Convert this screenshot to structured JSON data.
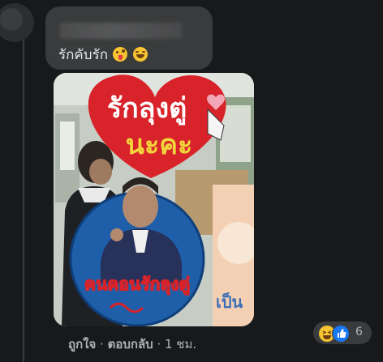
{
  "comment": {
    "text": "รักคับรัก",
    "emojis": [
      "zany-face",
      "grinning-squinting-face"
    ]
  },
  "photo": {
    "sign_top_line1": "รักลุงตู่",
    "sign_top_line2": "นะคะ",
    "sign_bottom": "คนคอนรักลุงตู่",
    "right_banner_text": "เป็น"
  },
  "footer": {
    "like": "ถูกใจ",
    "separator1": " · ",
    "reply": "ตอบกลับ",
    "separator2": " · ",
    "time": "1 ชม."
  },
  "reactions": {
    "count": "6",
    "icons": [
      "haha-icon",
      "like-icon"
    ]
  },
  "colors": {
    "background": "#18191a",
    "bubble": "#3a3b3c",
    "text": "#e4e6eb",
    "secondary": "#b0b3b8",
    "sign_red": "#d8232a",
    "sign_yellow": "#f2d43b",
    "sign_blue": "#1f5ea8"
  }
}
